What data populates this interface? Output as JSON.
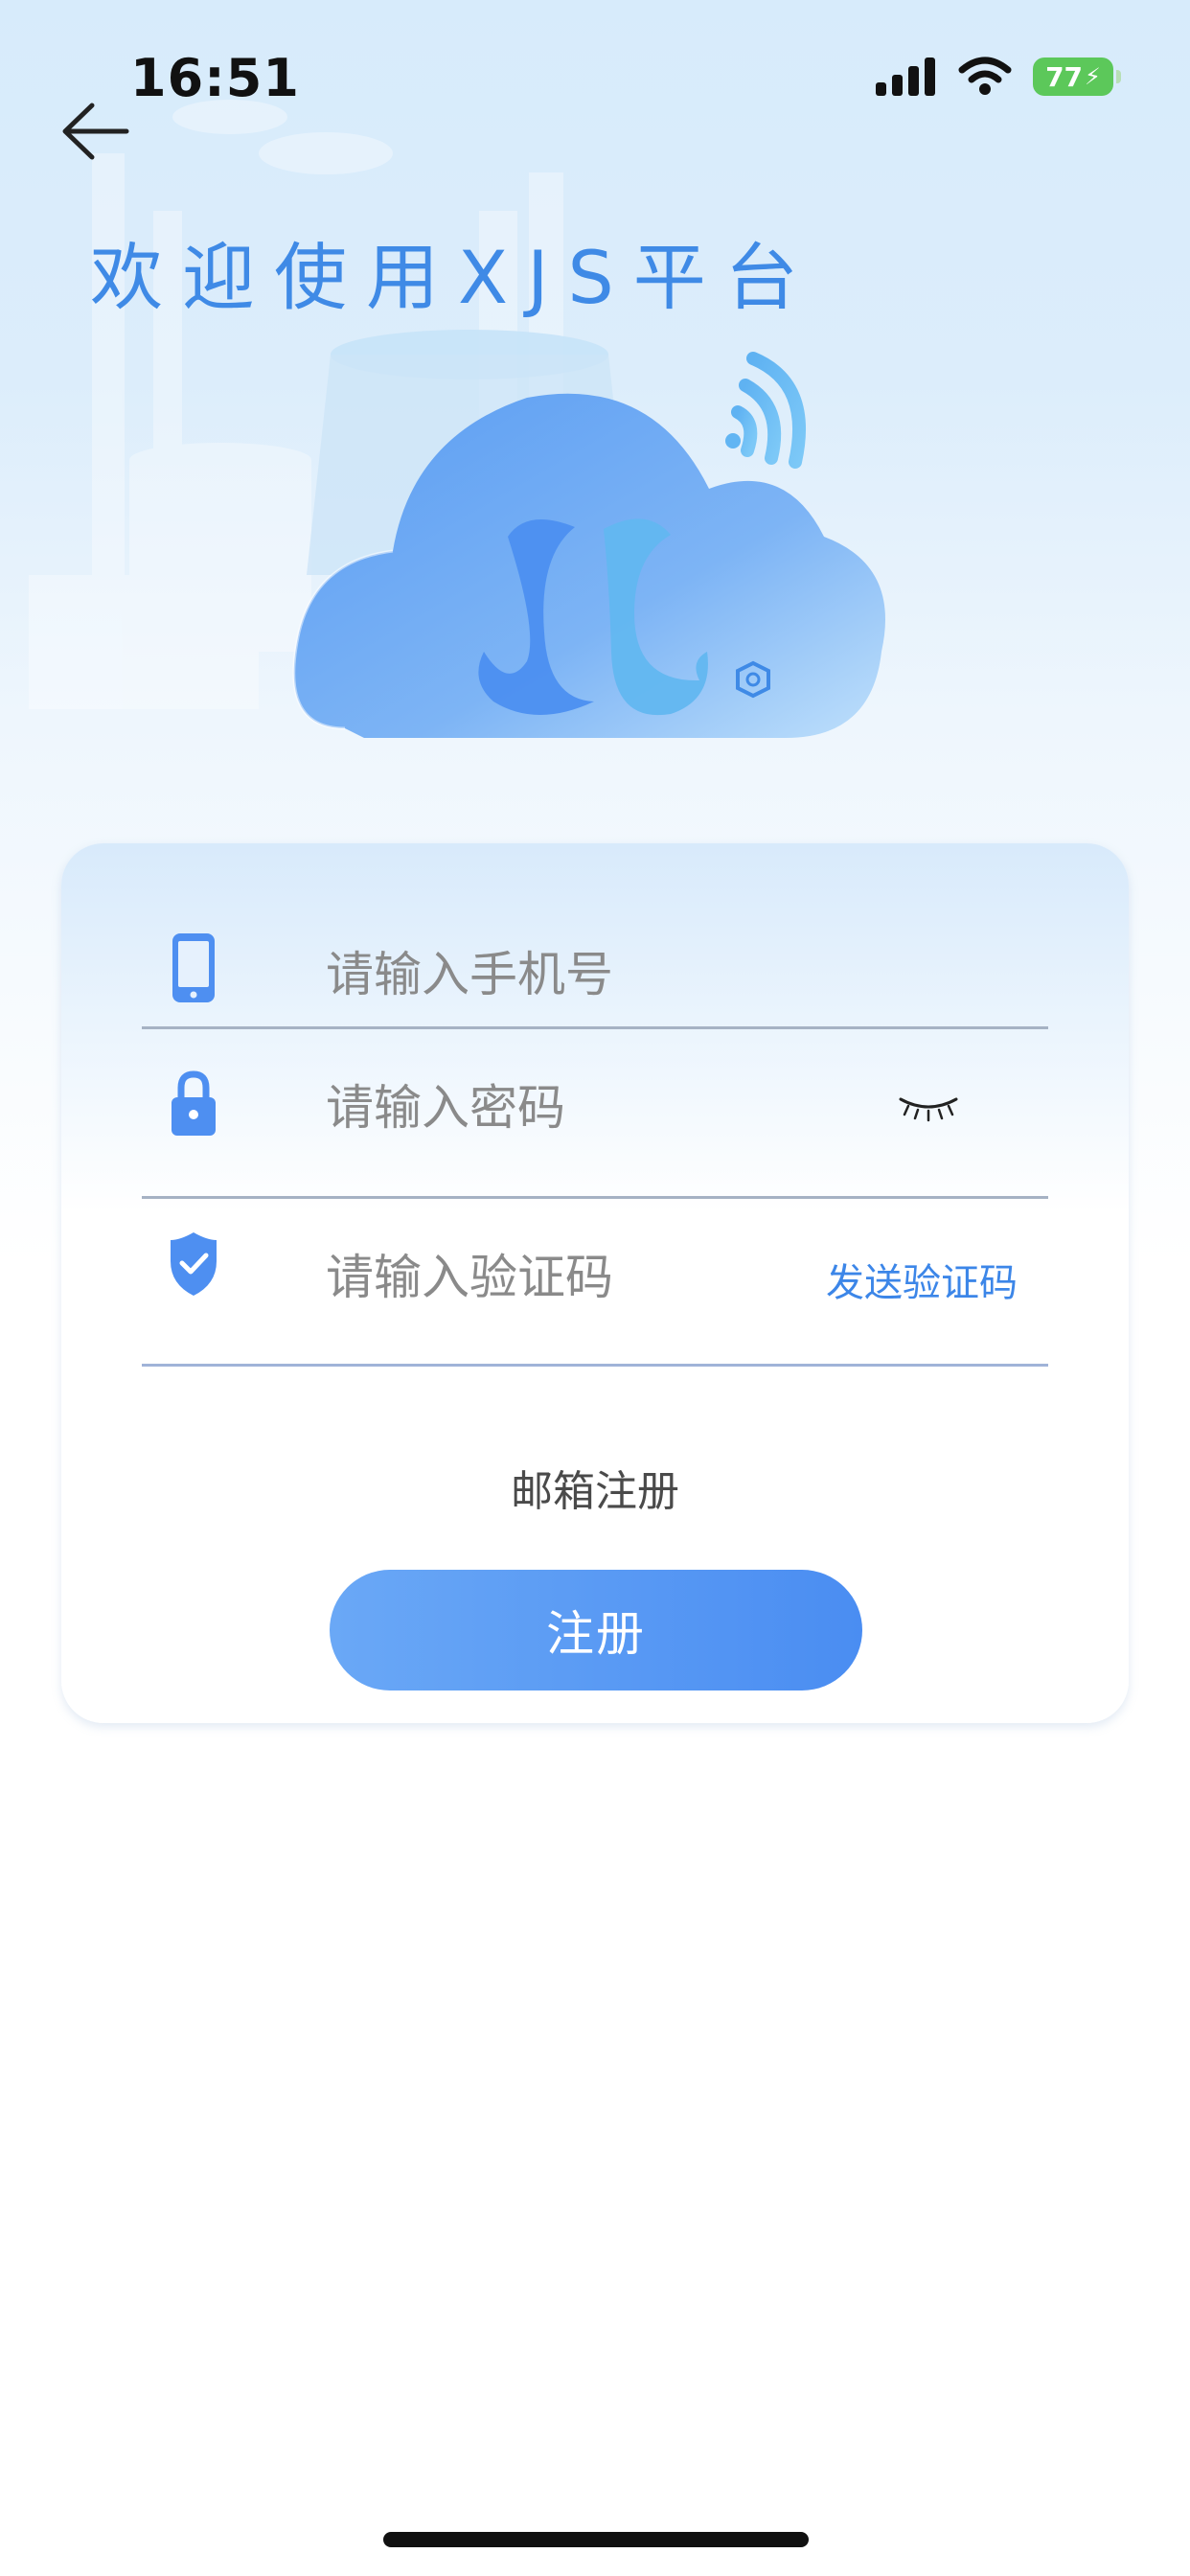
{
  "status_bar": {
    "time": "16:51",
    "battery": "77"
  },
  "header": {
    "title": "欢迎使用XJS平台"
  },
  "form": {
    "phone_placeholder": "请输入手机号",
    "password_placeholder": "请输入密码",
    "code_placeholder": "请输入验证码",
    "send_code_label": "发送验证码",
    "email_register_label": "邮箱注册",
    "register_button_label": "注册"
  },
  "colors": {
    "accent": "#3f8ae6",
    "button_start": "#6aa8f6",
    "button_end": "#4a8df2",
    "battery": "#5cc85a"
  },
  "icons": [
    "back-arrow-icon",
    "signal-icon",
    "wifi-icon",
    "battery-icon",
    "phone-icon",
    "lock-icon",
    "eye-closed-icon",
    "shield-check-icon",
    "cloud-logo-illustration"
  ]
}
